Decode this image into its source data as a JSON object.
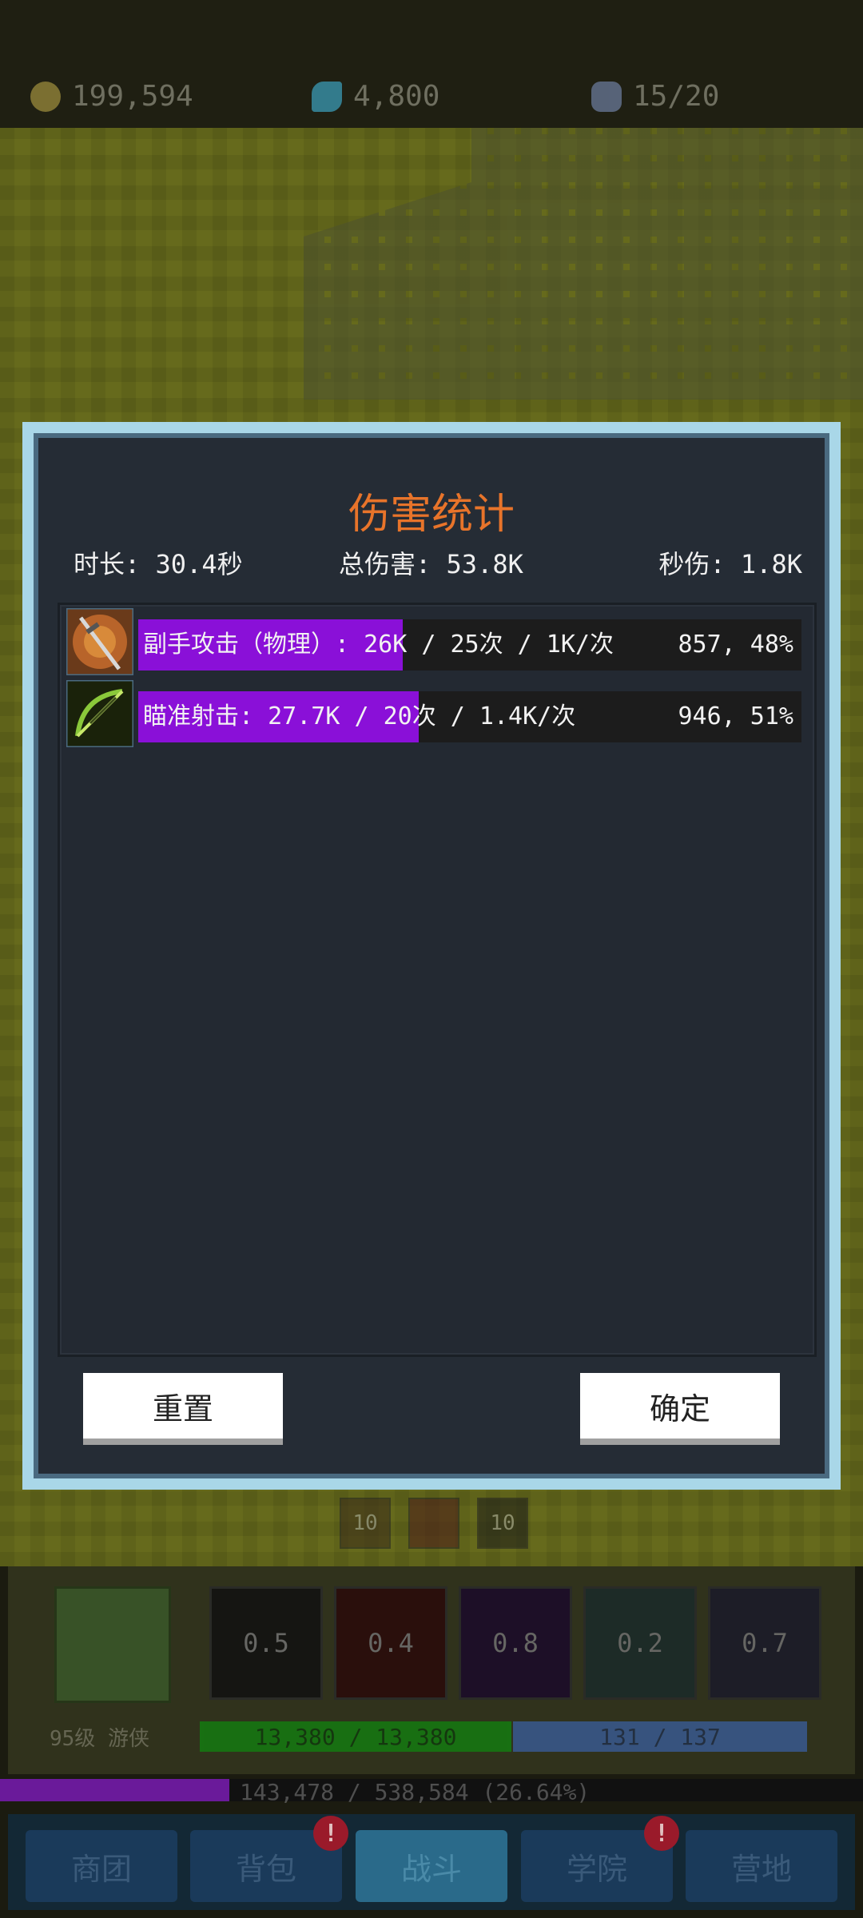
{
  "resources": {
    "gold": "199,594",
    "gems": "4,800",
    "energy": "15/20"
  },
  "dialog": {
    "title": "伤害统计",
    "duration": "时长: 30.4秒",
    "total_damage": "总伤害: 53.8K",
    "dps": "秒伤: 1.8K",
    "skills": [
      {
        "icon": "dagger-skill-icon",
        "label": "副手攻击（物理）: 26K / 25次 / 1K/次",
        "value": "857, 48%",
        "share": 0.48
      },
      {
        "icon": "crossbow-skill-icon",
        "label": "瞄准射击: 27.7K / 20次 / 1.4K/次",
        "value": "946, 51%",
        "share": 0.51
      }
    ],
    "reset_label": "重置",
    "confirm_label": "确定"
  },
  "hud": {
    "buffs": [
      "10",
      "",
      "10"
    ],
    "hero_name": "95级 游侠",
    "skill_cooldowns": [
      "0.5",
      "0.4",
      "0.8",
      "0.2",
      "0.7"
    ],
    "hp": "13,380 / 13,380",
    "mp": "131 / 137",
    "xp": "143,478 / 538,584 (26.64%)",
    "xp_fraction": 0.266
  },
  "nav": {
    "tabs": [
      "商团",
      "背包",
      "战斗",
      "学院",
      "营地"
    ],
    "active": "战斗"
  },
  "colors": {
    "title": "#e8742a",
    "bar_fill": "#8a10d8",
    "dialog_border": "#a9d7e8"
  }
}
